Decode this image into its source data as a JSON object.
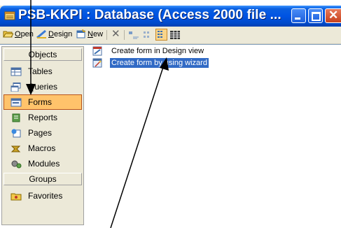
{
  "window": {
    "title": "PSB-KKPI : Database (Access 2000 file ..."
  },
  "toolbar": {
    "open_prefix": "",
    "open_u": "O",
    "open_rest": "pen",
    "design_u": "D",
    "design_rest": "esign",
    "new_u": "N",
    "new_rest": "ew"
  },
  "objects_panel": {
    "header": "Objects",
    "items": [
      {
        "label": "Tables",
        "icon": "table-icon"
      },
      {
        "label": "Queries",
        "icon": "query-icon"
      },
      {
        "label": "Forms",
        "icon": "form-icon",
        "selected": true
      },
      {
        "label": "Reports",
        "icon": "report-icon"
      },
      {
        "label": "Pages",
        "icon": "page-icon"
      },
      {
        "label": "Macros",
        "icon": "macro-icon"
      },
      {
        "label": "Modules",
        "icon": "module-icon"
      }
    ],
    "groups_header": "Groups",
    "groups": [
      {
        "label": "Favorites",
        "icon": "favorites-folder-icon"
      }
    ]
  },
  "list": {
    "items": [
      {
        "label": "Create form in Design view",
        "icon": "design-view-icon"
      },
      {
        "label": "Create form by using wizard",
        "icon": "wizard-icon",
        "selected": true
      }
    ]
  },
  "colors": {
    "title_bar": "#0054e3",
    "selection_orange": "#ffc36b",
    "list_selection": "#316ac5",
    "annotation_arrow": "#000000"
  }
}
